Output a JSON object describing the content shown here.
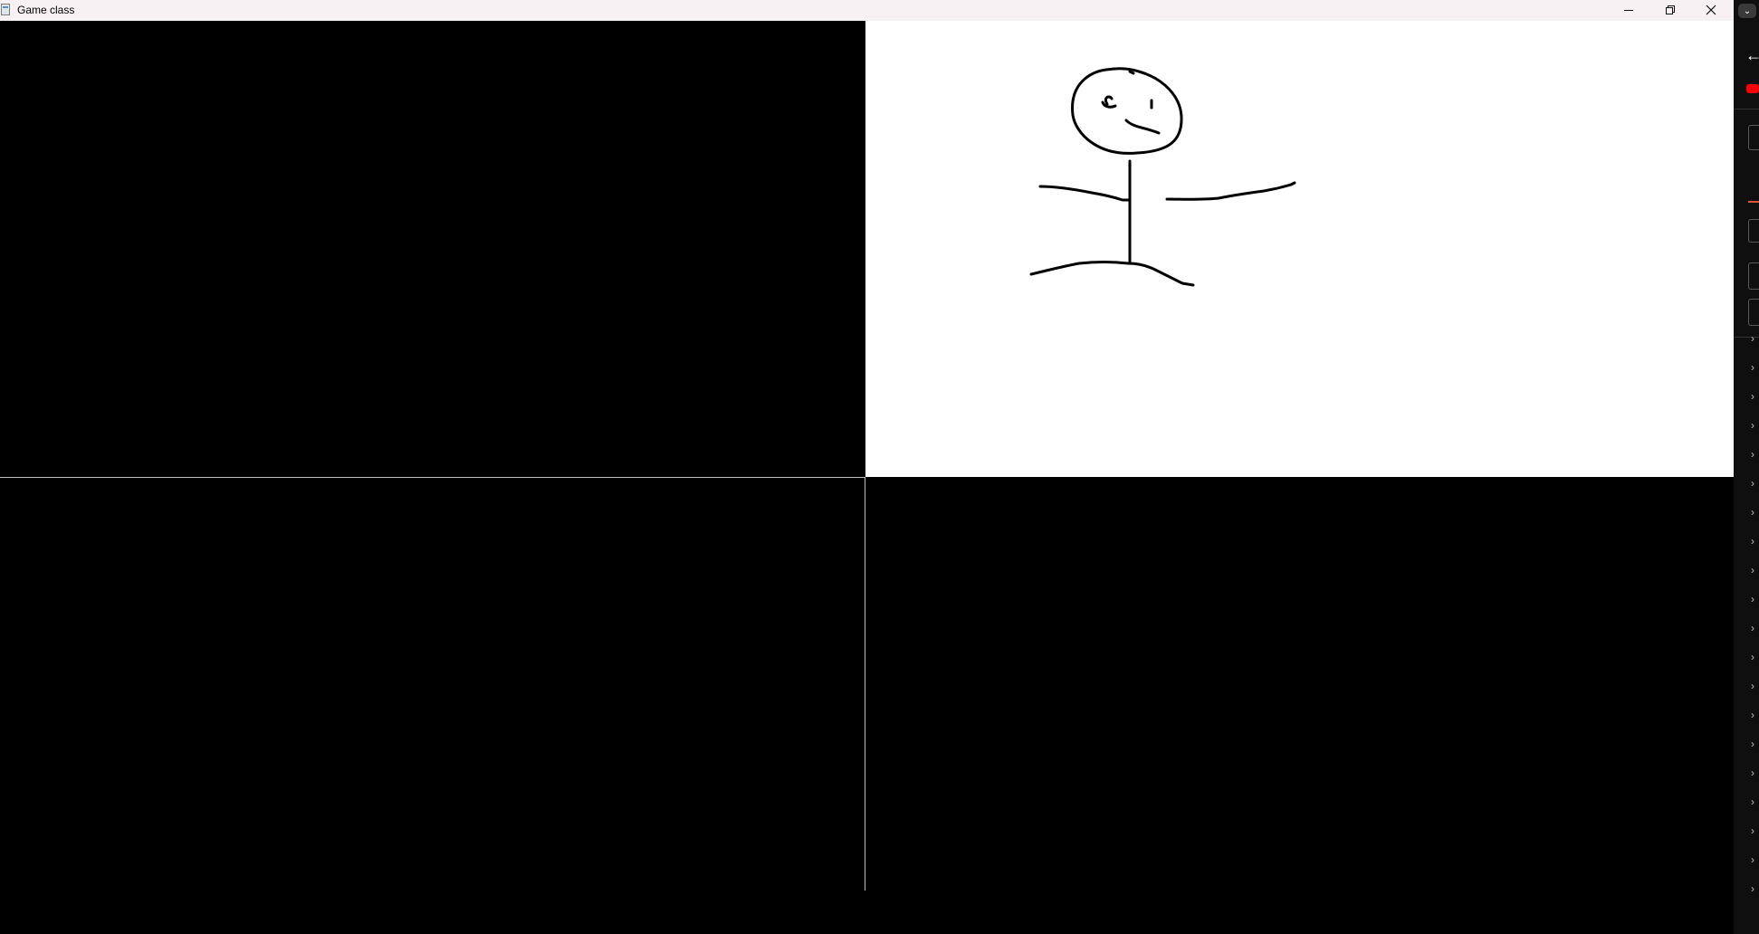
{
  "window": {
    "title": "Game class",
    "controls": {
      "minimize_glyph": "—",
      "restore_glyph": "❐",
      "close_glyph": "✕"
    }
  },
  "viewports": [
    {
      "id": "top-left",
      "color": "#000000"
    },
    {
      "id": "top-right",
      "color": "#ffffff",
      "content": "stick-figure-drawing"
    },
    {
      "id": "bottom-left",
      "color": "#000000"
    },
    {
      "id": "bottom-right",
      "color": "#000000"
    }
  ],
  "side_strip": {
    "dropdown_glyph": "⌄",
    "back_glyph": "←",
    "chevron_glyph": "›",
    "chevron_count": 20,
    "colors": {
      "background": "#0f0f0f",
      "accent": "#ff0000"
    }
  }
}
